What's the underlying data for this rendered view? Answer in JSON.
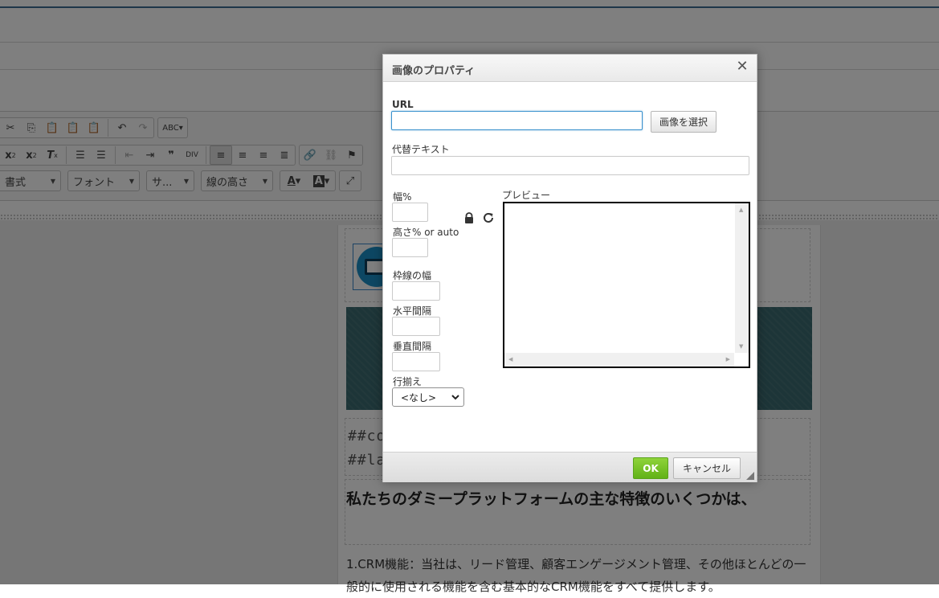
{
  "editor": {
    "combos": [
      {
        "label": "書式"
      },
      {
        "label": "フォント"
      },
      {
        "label": "サ..."
      },
      {
        "label": "線の高さ"
      }
    ],
    "doc": {
      "code_line_1": "##co",
      "code_line_2": "##la",
      "heading": "私たちのダミープラットフォームの主な特徴のいくつかは、",
      "paragraph": "1.CRM機能：当社は、リード管理、顧客エンゲージメント管理、その他ほとんどの一般的に使用される機能を含む基本的なCRM機能をすべて提供します。"
    }
  },
  "dialog": {
    "title": "画像のプロパティ",
    "url_label": "URL",
    "url_value": "",
    "select_image_label": "画像を選択",
    "alt_label": "代替テキスト",
    "alt_value": "",
    "width_label": "幅%",
    "height_label": "高さ% or auto",
    "border_label": "枠線の幅",
    "hspace_label": "水平間隔",
    "vspace_label": "垂直間隔",
    "align_label": "行揃え",
    "align_value": "<なし>",
    "preview_label": "プレビュー",
    "ok_label": "OK",
    "cancel_label": "キャンセル"
  },
  "colors": {
    "ok_button": "#6abf1f",
    "focus_border": "#3a91cd",
    "title_bar": "#eeeeee"
  }
}
